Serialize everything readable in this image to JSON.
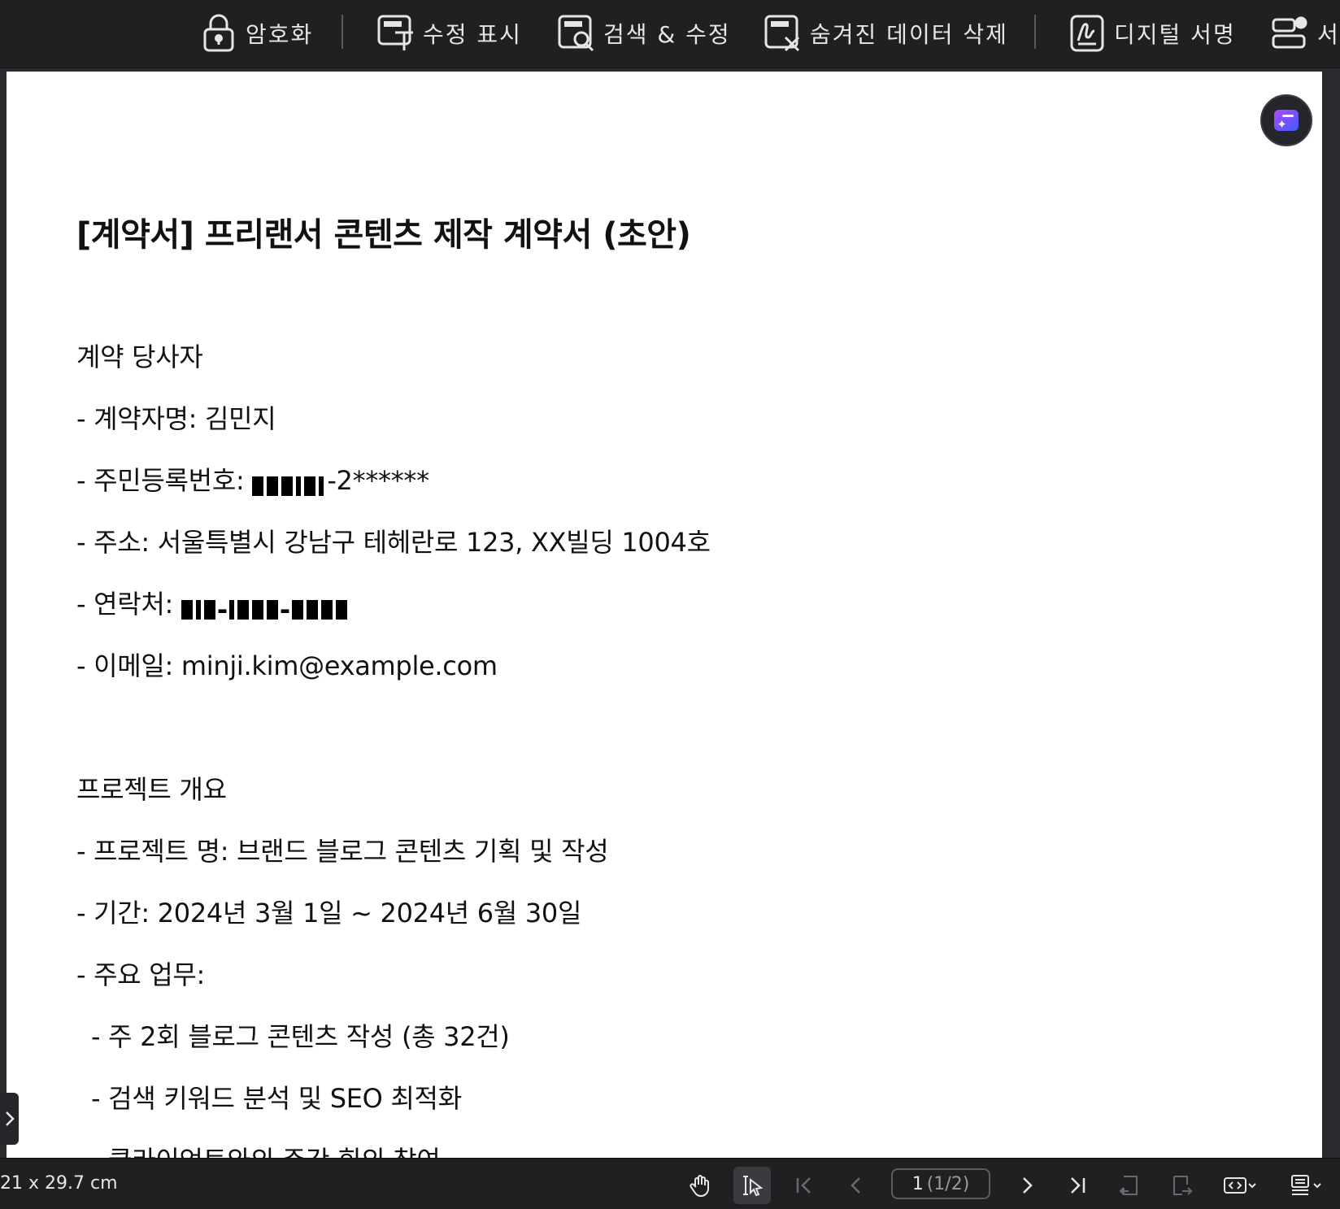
{
  "toolbar": {
    "items": [
      {
        "label": "암호화",
        "icon": "lock-icon"
      },
      {
        "label": "수정 표시",
        "icon": "mark-redaction-icon"
      },
      {
        "label": "검색 & 수정",
        "icon": "search-redact-icon"
      },
      {
        "label": "숨겨진 데이터 삭제",
        "icon": "remove-hidden-data-icon"
      },
      {
        "label": "디지털 서명",
        "icon": "digital-signature-icon"
      },
      {
        "label": "서",
        "icon": "settings-user-icon"
      }
    ]
  },
  "document": {
    "title": "[계약서] 프리랜서 콘텐츠 제작 계약서 (초안)",
    "sections": {
      "parties_heading": "계약 당사자",
      "name_line": "- 계약자명: 김민지",
      "rrn_label": "- 주민등록번호: ",
      "rrn_suffix": "-2******",
      "address_line": "- 주소: 서울특별시 강남구 테헤란로 123, XX빌딩 1004호",
      "contact_label": "- 연락처: ",
      "email_line": "- 이메일: minji.kim@example.com",
      "project_heading": "프로젝트 개요",
      "project_name_line": "- 프로젝트 명: 브랜드 블로그 콘텐츠 기획 및 작성",
      "period_line": "- 기간: 2024년 3월 1일 ~ 2024년 6월 30일",
      "tasks_label": "- 주요 업무:",
      "task_1": "- 주 2회 블로그 콘텐츠 작성 (총 32건)",
      "task_2": "- 검색 키워드 분석 및 SEO 최적화",
      "task_3": "- 클라이언트와의 주간 회의 참여"
    }
  },
  "statusbar": {
    "page_size": "21 x 29.7 cm",
    "current_page": "1",
    "page_total": "(1/2)"
  },
  "colors": {
    "toolbar_bg": "#202023",
    "accent_fab": "#6b4dff",
    "redaction": "#000000"
  }
}
